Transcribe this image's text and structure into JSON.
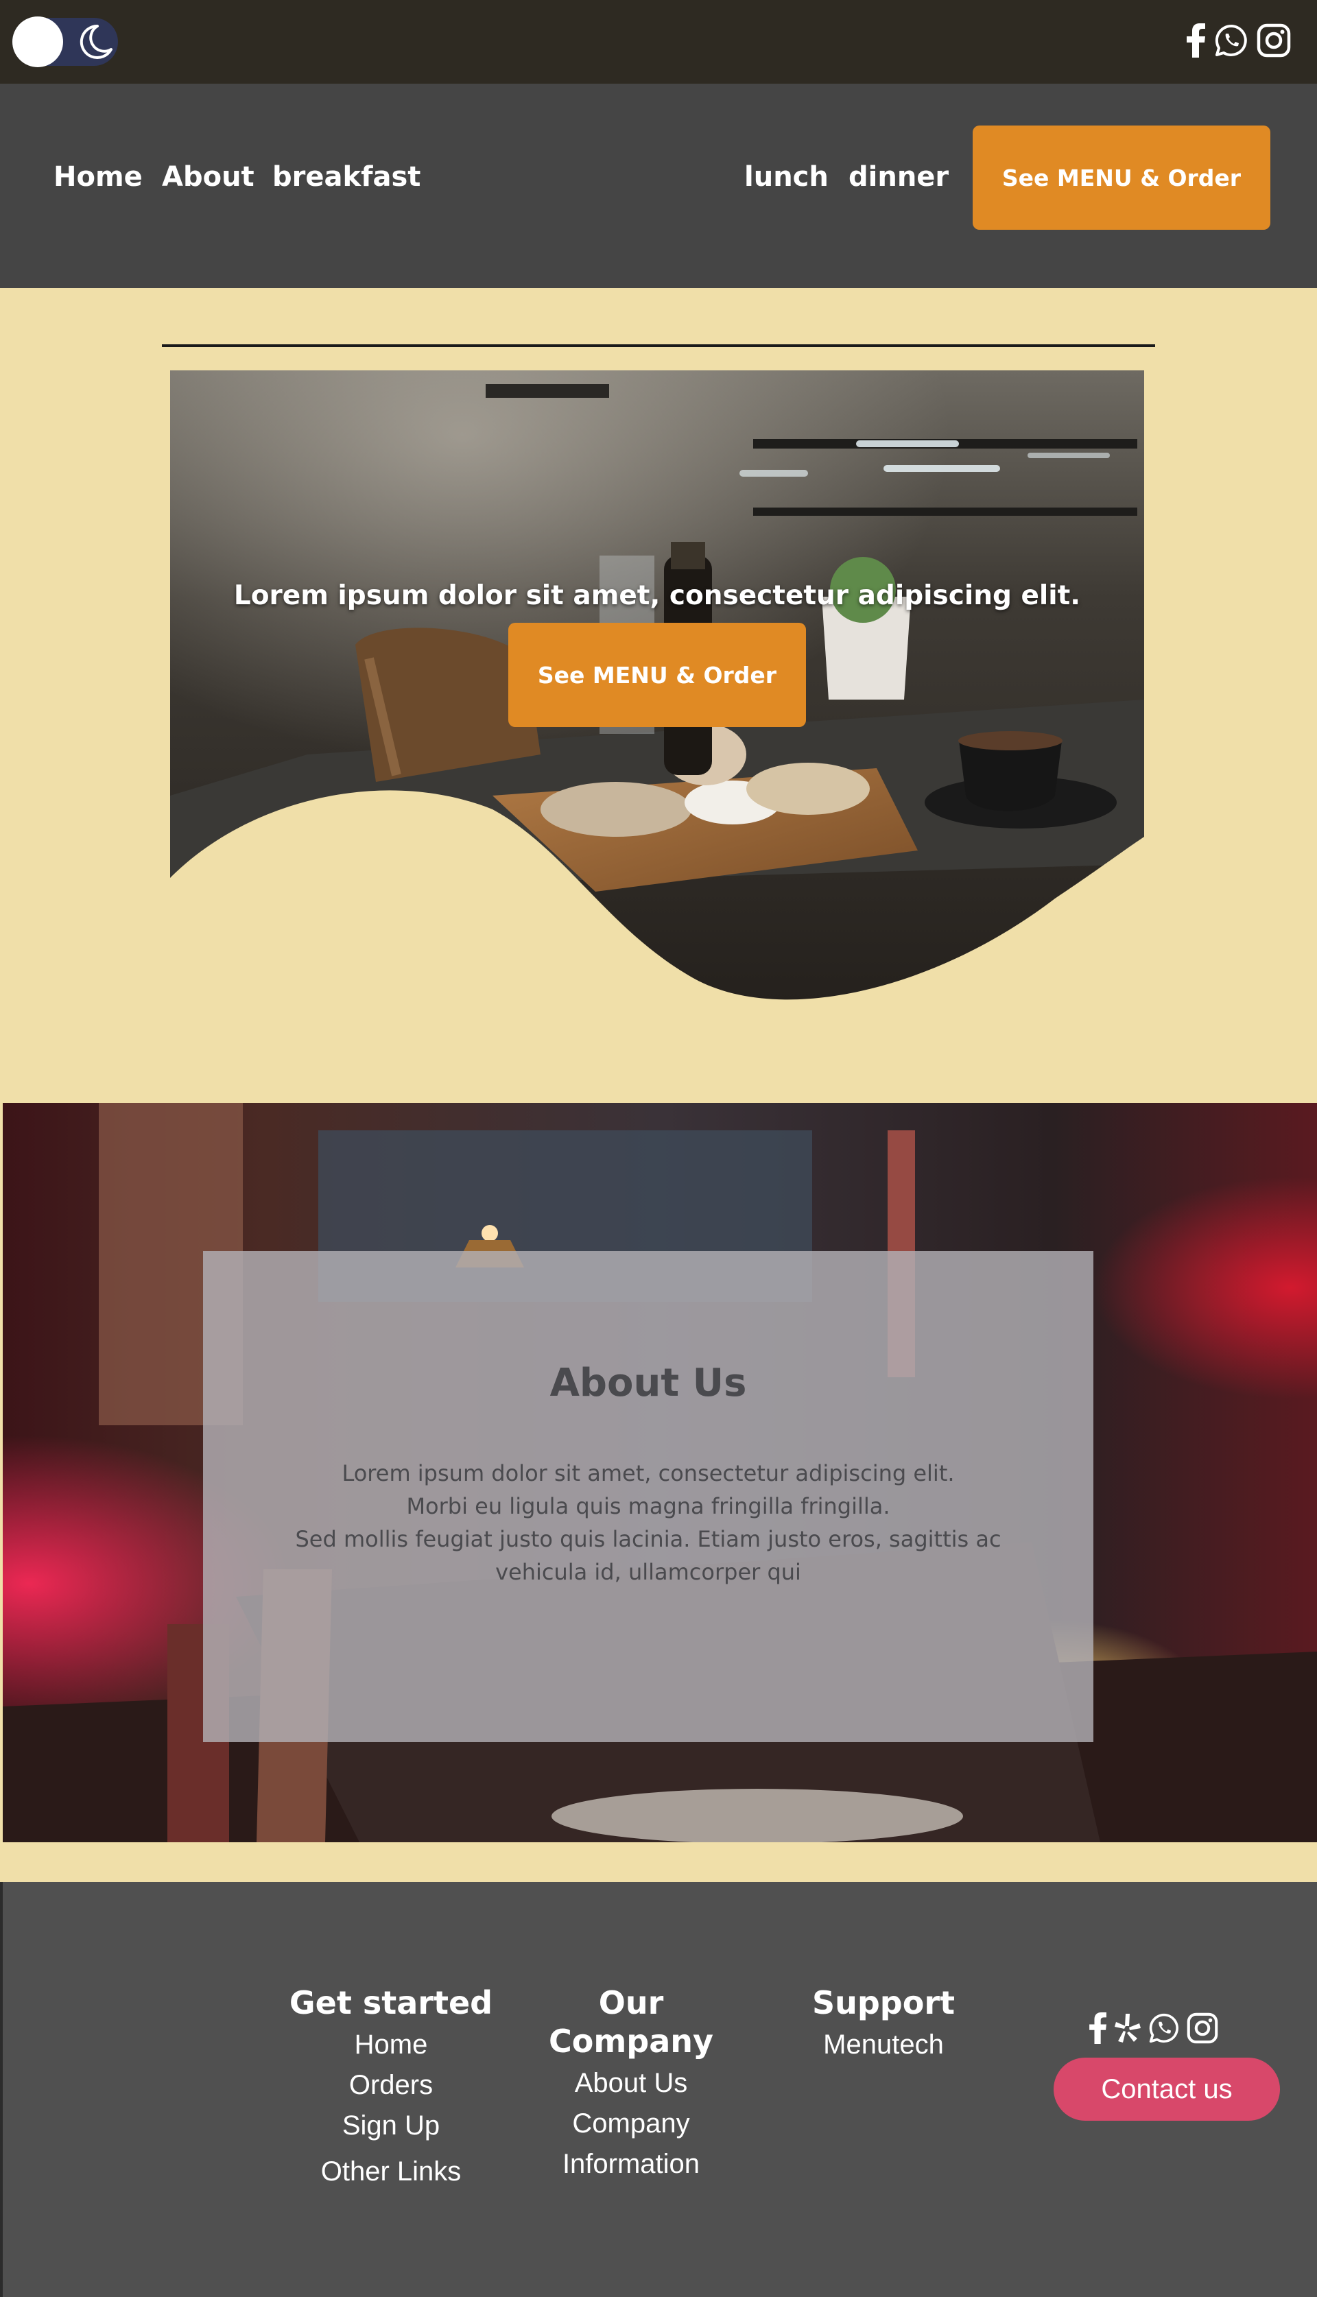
{
  "theme_toggle": {
    "icon": "moon-icon"
  },
  "top_social": [
    "facebook-icon",
    "whatsapp-icon",
    "instagram-icon"
  ],
  "nav": {
    "links": [
      "Home",
      "About",
      "breakfast",
      "lunch",
      "dinner"
    ],
    "cta": "See MENU & Order"
  },
  "hero": {
    "tagline": "Lorem ipsum dolor sit amet, consectetur adipiscing elit.",
    "cta": "See MENU & Order"
  },
  "about": {
    "title": "About Us",
    "lines": [
      "Lorem ipsum dolor sit amet, consectetur adipiscing elit.",
      "Morbi eu ligula quis magna fringilla fringilla.",
      "Sed mollis feugiat justo quis lacinia. Etiam justo eros, sagittis ac",
      "vehicula id, ullamcorper qui"
    ]
  },
  "footer": {
    "get_started": {
      "title": "Get started",
      "links": [
        "Home",
        "Orders",
        "Sign Up"
      ],
      "extra": "Other Links"
    },
    "our_company": {
      "title": "Our Company",
      "links": [
        "About Us",
        "Company",
        "Information"
      ]
    },
    "support": {
      "title": "Support",
      "links": [
        "Menutech"
      ]
    },
    "social": [
      "facebook-icon",
      "yelp-icon",
      "whatsapp-icon",
      "instagram-icon"
    ],
    "contact": "Contact us"
  },
  "colors": {
    "page_background": "#f0dfa9",
    "top_bar": "#2e2a22",
    "nav_background": "#454545",
    "accent_orange": "#e08a24",
    "footer_background": "#505050",
    "contact_pink": "#d8486a"
  }
}
